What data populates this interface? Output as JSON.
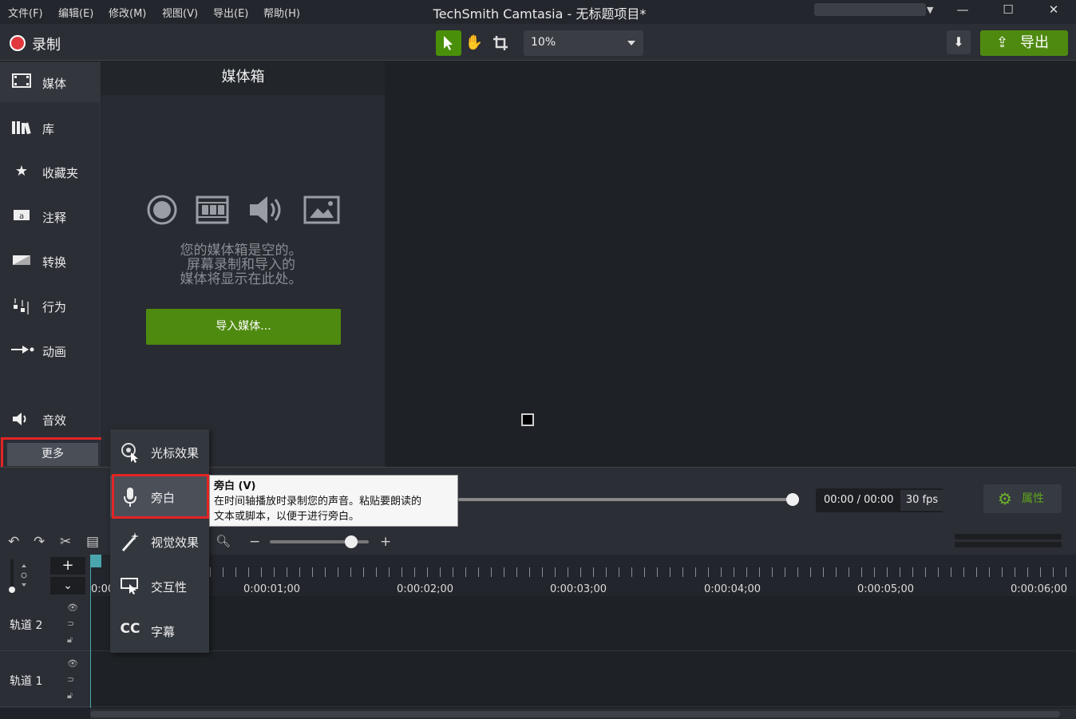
{
  "menubar": {
    "items": [
      "文件(F)",
      "编辑(E)",
      "修改(M)",
      "视图(V)",
      "导出(E)",
      "帮助(H)"
    ],
    "title": "TechSmith Camtasia - 无标题项目*"
  },
  "toolbar": {
    "record_label": "录制",
    "zoom_value": "10%",
    "export_label": "导出"
  },
  "sidebar": {
    "items": [
      {
        "label": "媒体",
        "icon": "film-strip-icon"
      },
      {
        "label": "库",
        "icon": "library-icon"
      },
      {
        "label": "收藏夹",
        "icon": "star-icon"
      },
      {
        "label": "注释",
        "icon": "annotation-icon"
      },
      {
        "label": "转换",
        "icon": "transition-icon"
      },
      {
        "label": "行为",
        "icon": "behavior-icon"
      },
      {
        "label": "动画",
        "icon": "animation-icon"
      },
      {
        "label": "音效",
        "icon": "speaker-icon"
      }
    ],
    "more_label": "更多"
  },
  "mediabin": {
    "header": "媒体箱",
    "empty_lines": [
      "您的媒体箱是空的。",
      "屏幕录制和导入的",
      "媒体将显示在此处。"
    ],
    "import_label": "导入媒体..."
  },
  "flyout": {
    "items": [
      {
        "label": "光标效果",
        "icon": "cursor-effect-icon"
      },
      {
        "label": "旁白",
        "icon": "microphone-icon"
      },
      {
        "label": "视觉效果",
        "icon": "magic-wand-icon"
      },
      {
        "label": "交互性",
        "icon": "interactivity-icon"
      },
      {
        "label": "字幕",
        "icon": "cc-icon"
      }
    ]
  },
  "tooltip": {
    "title": "旁白 (V)",
    "desc_line1": "在时间轴播放时录制您的声音。粘贴要朗读的",
    "desc_line2": "文本或脚本，以便于进行旁白。"
  },
  "playback": {
    "time": "00:00 / 00:00",
    "fps": "30 fps",
    "properties_label": "属性"
  },
  "timeline": {
    "start_label": "0:00",
    "times": [
      "0:00:01;00",
      "0:00:02;00",
      "0:00:03;00",
      "0:00:04;00",
      "0:00:05;00",
      "0:00:06;00"
    ],
    "tracks": [
      "轨道 2",
      "轨道 1"
    ]
  },
  "colors": {
    "accent_green": "#4f8a10",
    "record_red": "#e0383e",
    "highlight_red": "#e32424",
    "playhead_teal": "#4aa6ad"
  }
}
